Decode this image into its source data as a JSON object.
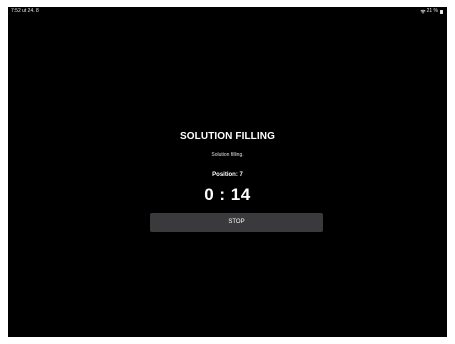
{
  "status_bar": {
    "left_text": "7:52  ut 24. 8",
    "battery_text": "21 %",
    "icons": [
      "wifi-icon",
      "battery-icon"
    ]
  },
  "screen": {
    "title": "SOLUTION FILLING",
    "subtitle": "Solution filling.",
    "position_label": "Position: 7",
    "timer": "0 : 14",
    "stop_label": "STOP"
  },
  "colors": {
    "background": "#000000",
    "text": "#ffffff",
    "button": "#3a3a3c"
  }
}
